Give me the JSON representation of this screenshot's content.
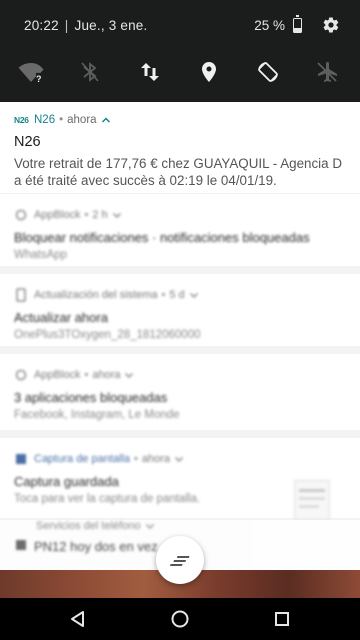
{
  "status_bar": {
    "time": "20:22",
    "separator": "|",
    "date": "Jue., 3 ene.",
    "battery_percent": "25 %",
    "battery_level": 0.25
  },
  "quick_tiles": [
    {
      "name": "wifi",
      "icon": "wifi-icon",
      "active": false,
      "badge": "?"
    },
    {
      "name": "bluetooth",
      "icon": "bluetooth-icon",
      "active": false
    },
    {
      "name": "mobile-data",
      "icon": "data-arrows-icon",
      "active": true
    },
    {
      "name": "location",
      "icon": "location-pin-icon",
      "active": true
    },
    {
      "name": "auto-rotate",
      "icon": "rotate-icon",
      "active": true
    },
    {
      "name": "airplane",
      "icon": "airplane-icon",
      "active": false
    }
  ],
  "notifications": [
    {
      "app_icon_text": "N26",
      "app": "N26",
      "time": "ahora",
      "title": "N26",
      "body": "Votre retrait de 177,76 € chez GUAYAQUIL - Agencia D a été traité avec succès à 02:19 le 04/01/19.",
      "accent": "#15848a"
    },
    {
      "app": "AppBlock",
      "time": "2 h",
      "title": "Bloquear notificaciones · notificaciones bloqueadas",
      "body": "WhatsApp",
      "blurred": true
    },
    {
      "app": "Actualización del sistema",
      "time": "5 d",
      "title": "Actualizar ahora",
      "body": "OnePlus3TOxygen_28_1812060000",
      "blurred": true
    },
    {
      "app": "AppBlock",
      "time": "ahora",
      "title": "3 aplicaciones bloqueadas",
      "body": "Facebook, Instagram, Le Monde",
      "blurred": true
    },
    {
      "app": "Captura de pantalla",
      "time": "ahora",
      "title": "Captura guardada",
      "body": "Toca para ver la captura de pantalla.",
      "blurred": true,
      "accent": "#4a6fa5"
    },
    {
      "app": "Servicios del teléfono",
      "title": "PN12 hoy dos en vez",
      "blurred": true
    }
  ],
  "colors": {
    "header_bg": "#1b1c1c",
    "panel_bg": "#f3f3f3",
    "n26_teal": "#15848a"
  }
}
